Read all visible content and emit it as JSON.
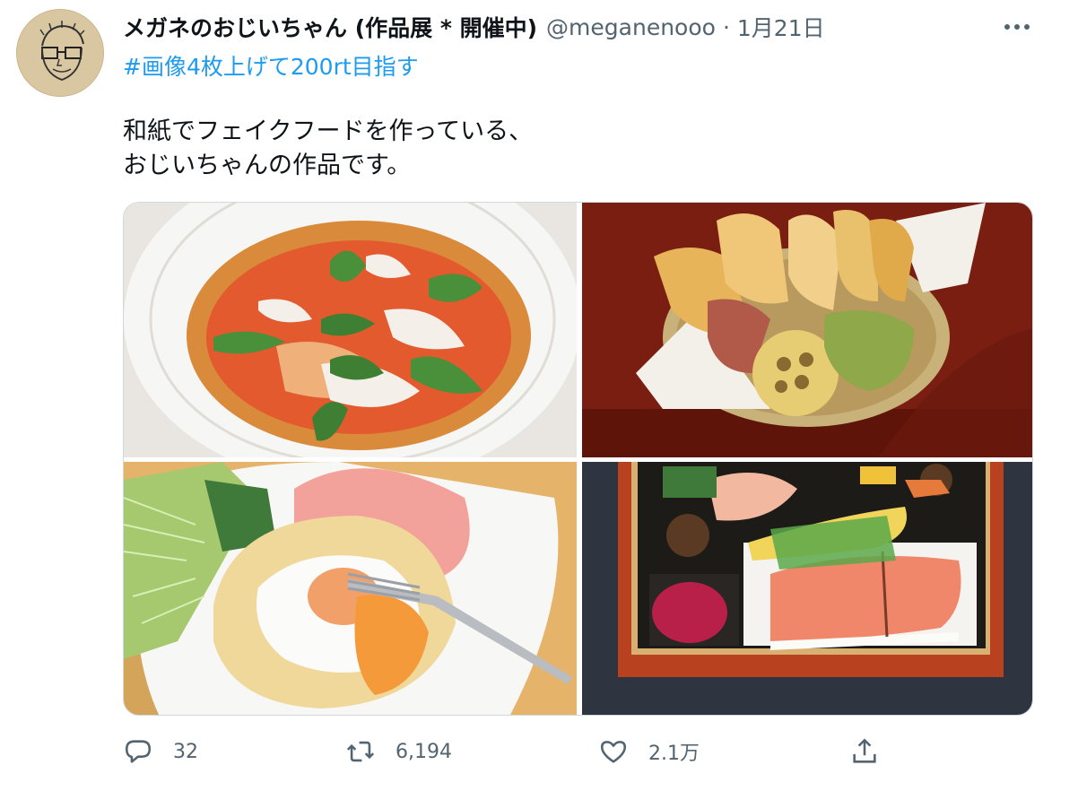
{
  "tweet": {
    "display_name": "メガネのおじいちゃん (作品展 * 開催中)",
    "handle": "@meganenooo",
    "separator": "·",
    "date": "1月21日",
    "hashtag": "#画像4枚上げて200rt目指す",
    "body_lines": [
      "和紙でフェイクフードを作っている、",
      "おじいちゃんの作品です。"
    ],
    "more_icon": "more-horizontal-icon"
  },
  "media": [
    {
      "name": "pizza-image"
    },
    {
      "name": "tempura-image"
    },
    {
      "name": "egg-ham-image"
    },
    {
      "name": "bento-image"
    }
  ],
  "actions": {
    "reply": {
      "icon": "reply-icon",
      "count": "32"
    },
    "retweet": {
      "icon": "retweet-icon",
      "count": "6,194"
    },
    "like": {
      "icon": "heart-icon",
      "count": "2.1万"
    },
    "share": {
      "icon": "share-icon"
    }
  },
  "colors": {
    "link": "#1d9bf0",
    "muted": "#536471",
    "text": "#0f1419",
    "border": "#cfd9de"
  }
}
